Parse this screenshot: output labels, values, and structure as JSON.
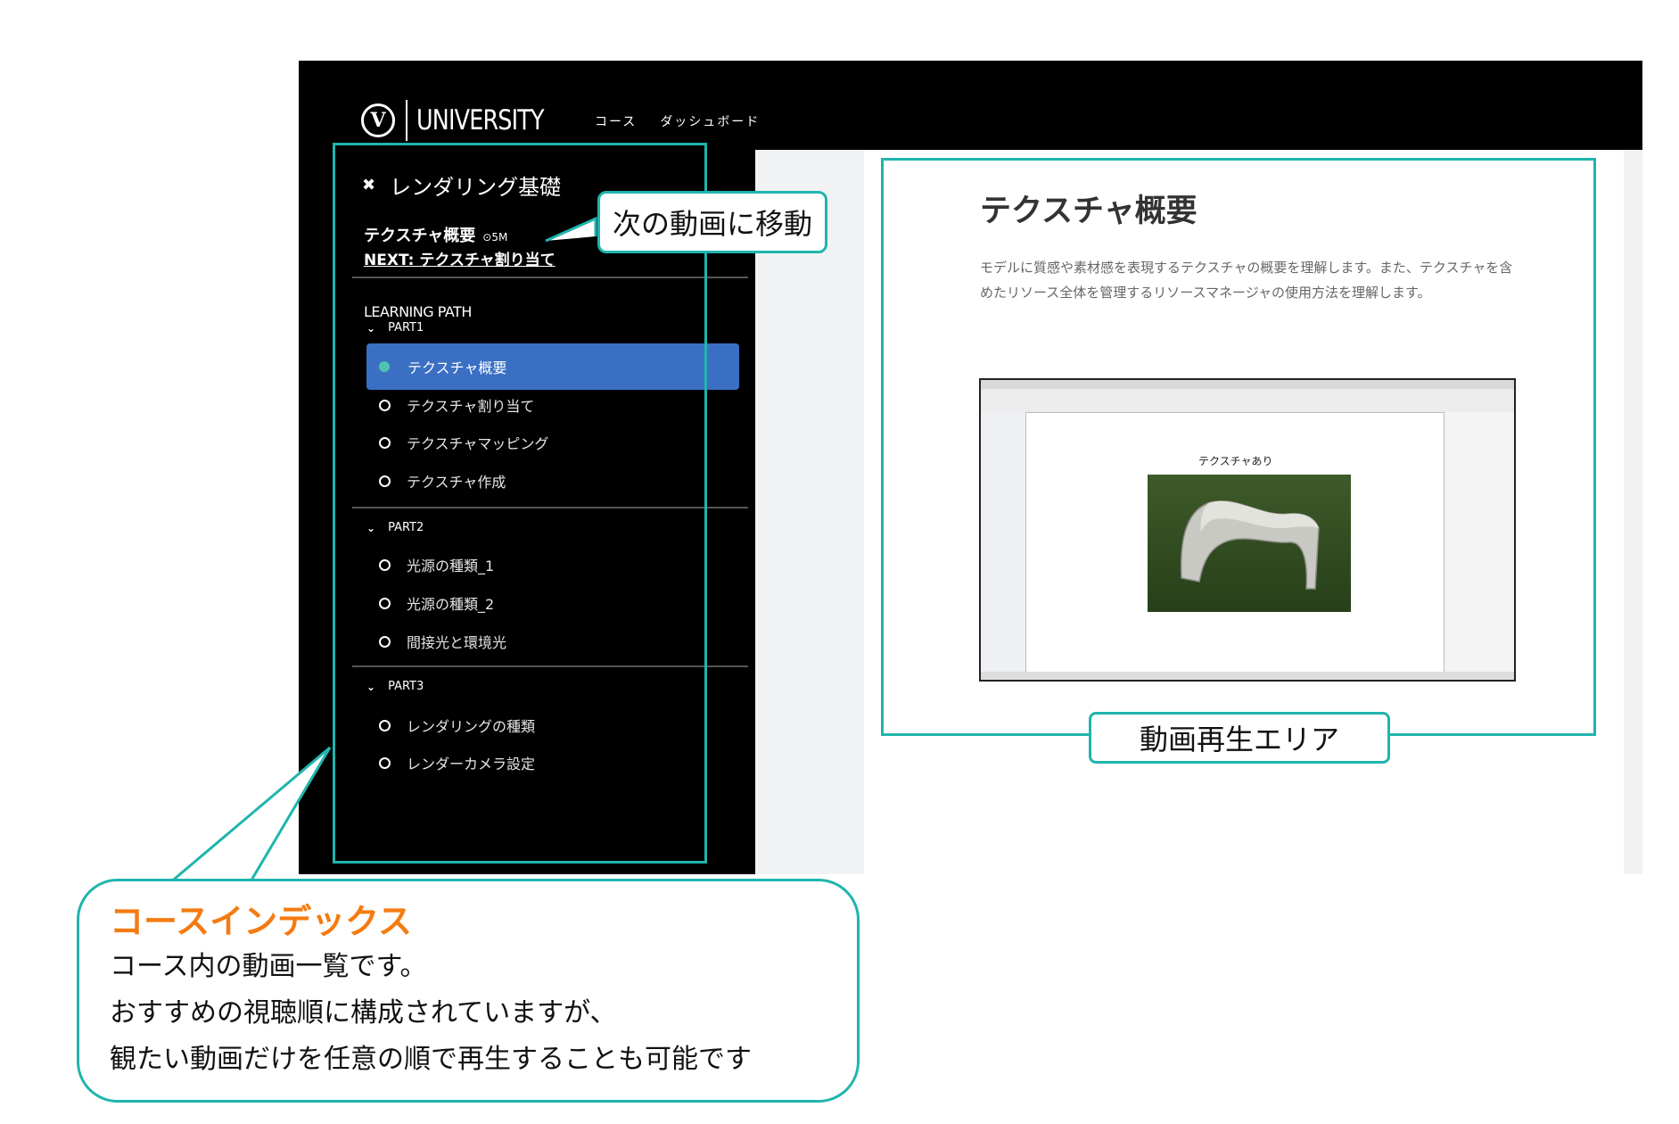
{
  "header": {
    "logo_mark": "V",
    "logo_text": "UNIVERSITY",
    "nav": [
      "コース",
      "ダッシュボード"
    ]
  },
  "sidebar": {
    "close_icon": "close-icon",
    "course_title": "レンダリング基礎",
    "current_lesson": "テクスチャ概要",
    "current_duration": "⊙5M",
    "next_link": "NEXT: テクスチャ割り当て",
    "learning_path_label": "LEARNING PATH",
    "parts": [
      {
        "label": "PART1",
        "items": [
          "テクスチャ概要",
          "テクスチャ割り当て",
          "テクスチャマッピング",
          "テクスチャ作成"
        ]
      },
      {
        "label": "PART2",
        "items": [
          "光源の種類_1",
          "光源の種類_2",
          "間接光と環境光"
        ]
      },
      {
        "label": "PART3",
        "items": [
          "レンダリングの種類",
          "レンダーカメラ設定"
        ]
      }
    ],
    "active_item": "テクスチャ概要"
  },
  "content": {
    "lesson_title": "テクスチャ概要",
    "lesson_description": "モデルに質感や素材感を表現するテクスチャの概要を理解します。また、テクスチャを含めたリソース全体を管理するリソースマネージャの使用方法を理解します。",
    "screenshot_label": "テクスチャあり"
  },
  "annotations": {
    "next_callout": "次の動画に移動",
    "video_area_callout": "動画再生エリア",
    "index_title": "コースインデックス",
    "index_lines": [
      "コース内の動画一覧です。",
      "おすすめの視聴順に構成されていますが、",
      "観たい動画だけを任意の順で再生することも可能です"
    ]
  },
  "colors": {
    "callout": "#1fb5ad",
    "active_item": "#3a6fc4",
    "active_dot": "#4fc3b0",
    "index_title": "#f47b12"
  }
}
